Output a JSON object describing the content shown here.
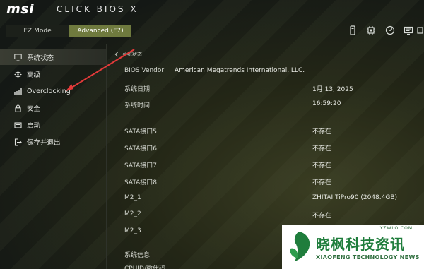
{
  "header": {
    "brand": "msi",
    "title": "CLICK BIOS X",
    "modes": {
      "ez": "EZ Mode",
      "advanced": "Advanced (F7)"
    },
    "active_mode": "advanced",
    "toolbar_icons": [
      "usb-drive-icon",
      "cpu-icon",
      "gauge-icon",
      "monitor-icon",
      "more-icon"
    ]
  },
  "sidebar": {
    "items": [
      {
        "label": "系统状态",
        "icon": "monitor-icon",
        "active": true
      },
      {
        "label": "高级",
        "icon": "gear-icon",
        "active": false
      },
      {
        "label": "Overclocking",
        "icon": "chart-icon",
        "active": false
      },
      {
        "label": "安全",
        "icon": "lock-icon",
        "active": false
      },
      {
        "label": "启动",
        "icon": "boot-icon",
        "active": false
      },
      {
        "label": "保存并退出",
        "icon": "exit-icon",
        "active": false
      }
    ]
  },
  "main": {
    "breadcrumb": "系统状态",
    "bios_vendor": {
      "label": "BIOS Vendor",
      "value": "American Megatrends International, LLC."
    },
    "system_date": {
      "label": "系统日期",
      "value": "1月 13, 2025"
    },
    "system_time": {
      "label": "系统时间",
      "value": "16:59:20"
    },
    "sata": [
      {
        "label": "SATA接口5",
        "value": "不存在"
      },
      {
        "label": "SATA接口6",
        "value": "不存在"
      },
      {
        "label": "SATA接口7",
        "value": "不存在"
      },
      {
        "label": "SATA接口8",
        "value": "不存在"
      }
    ],
    "m2": [
      {
        "label": "M2_1",
        "value": "ZHITAI TiPro90 (2048.4GB)"
      },
      {
        "label": "M2_2",
        "value": "不存在"
      },
      {
        "label": "M2_3",
        "value": ""
      }
    ],
    "sysinfo_label": "系统信息",
    "cpu_id_label": "CPUID/微代码"
  },
  "watermark": {
    "site": "YZWLO.COM",
    "name_cn": "晓枫科技资讯",
    "name_en": "XIAOFENG TECHNOLOGY NEWS"
  },
  "colors": {
    "accent": "#6f7a3e",
    "annotation_arrow": "#e23a3a",
    "watermark_green": "#1f7d3c"
  }
}
